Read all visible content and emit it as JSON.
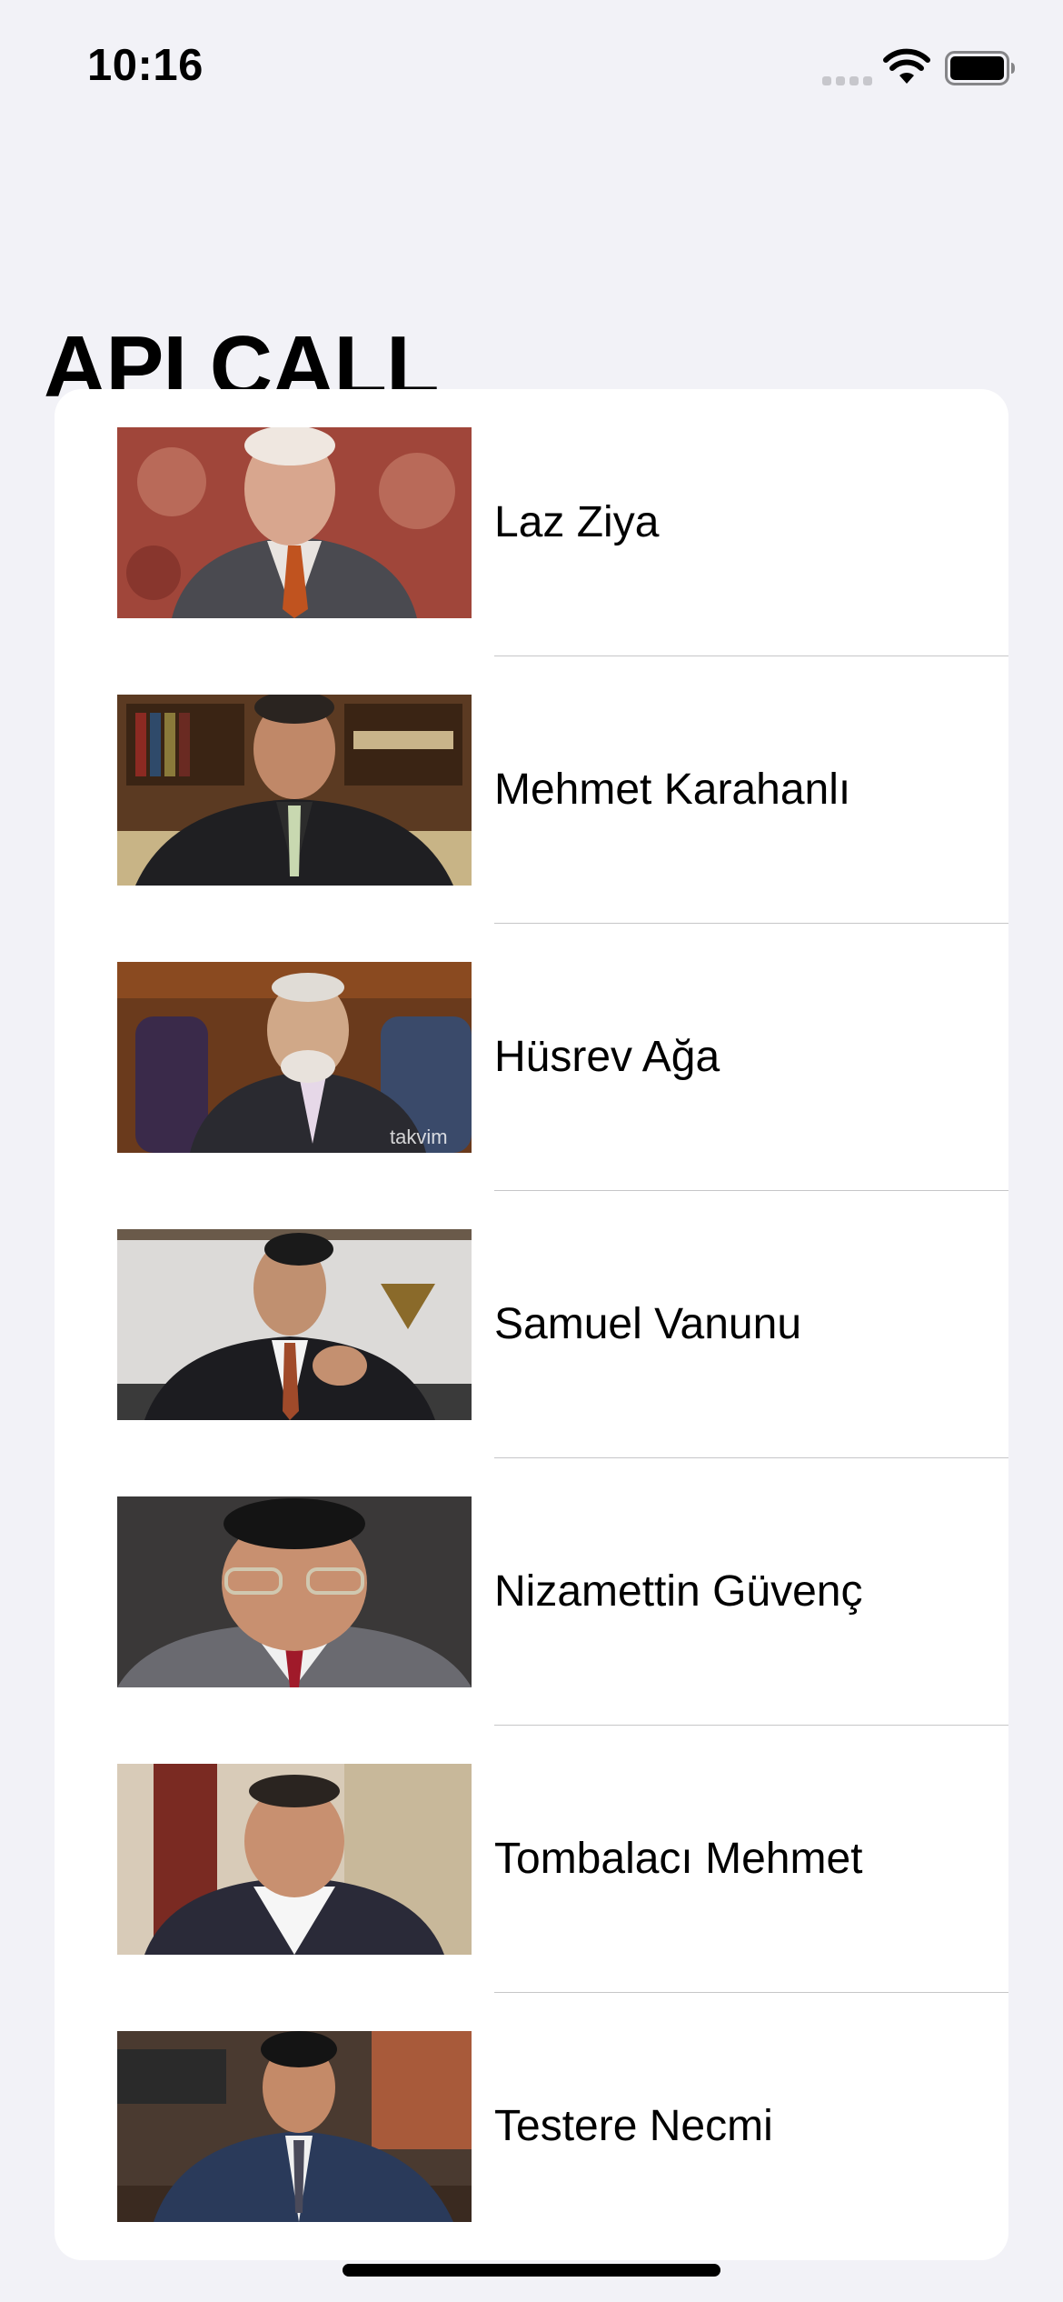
{
  "status_bar": {
    "time": "10:16",
    "icons": [
      "cellular-signal-icon",
      "wifi-icon",
      "battery-icon"
    ]
  },
  "header": {
    "title": "API CALL"
  },
  "list": {
    "items": [
      {
        "name": "Laz Ziya",
        "image": "portrait-photo"
      },
      {
        "name": "Mehmet Karahanlı",
        "image": "portrait-photo"
      },
      {
        "name": "Hüsrev Ağa",
        "image": "portrait-photo"
      },
      {
        "name": "Samuel Vanunu",
        "image": "portrait-photo"
      },
      {
        "name": "Nizamettin Güvenç",
        "image": "portrait-photo"
      },
      {
        "name": "Tombalacı Mehmet",
        "image": "portrait-photo"
      },
      {
        "name": "Testere Necmi",
        "image": "portrait-photo"
      }
    ]
  },
  "colors": {
    "background": "#f2f2f7",
    "card": "#ffffff",
    "separator": "#c6c6c8",
    "text": "#000000"
  }
}
